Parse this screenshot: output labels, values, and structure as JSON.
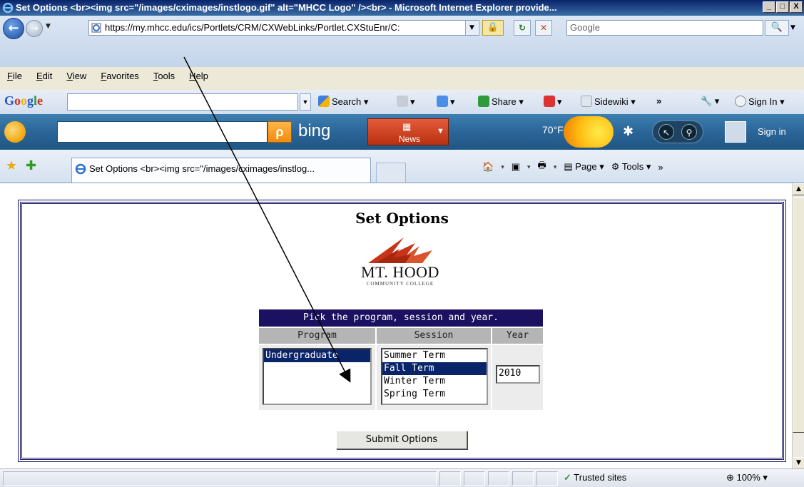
{
  "window": {
    "title": "Set Options <br><img src=\"/images/cximages/instlogo.gif\" alt=\"MHCC Logo\" /><br> - Microsoft Internet Explorer provide...",
    "minimize": "_",
    "maximize": "□",
    "close": "X"
  },
  "address_bar": {
    "url": "https://my.mhcc.edu/ics/Portlets/CRM/CXWebLinks/Portlet.CXStuEnr/C:",
    "search_placeholder": "Google"
  },
  "menu": [
    "File",
    "Edit",
    "View",
    "Favorites",
    "Tools",
    "Help"
  ],
  "google_toolbar": {
    "logo": "Google",
    "search_label": "Search",
    "share_label": "Share",
    "sidewiki_label": "Sidewiki",
    "more_label": "»",
    "signin_label": "Sign In"
  },
  "bing_bar": {
    "logo_text": "bing",
    "news_label": "News",
    "temperature": "70°F",
    "signin_label": "Sign in"
  },
  "tab": {
    "title": "Set Options <br><img src=\"/images/cximages/instlog..."
  },
  "command_bar": {
    "page_label": "Page",
    "tools_label": "Tools",
    "more_label": "»"
  },
  "page": {
    "title": "Set Options",
    "logo_line1": "MT. HOOD",
    "logo_line2": "COMMUNITY COLLEGE",
    "table_heading": "Pick the program, session and year.",
    "col_program": "Program",
    "col_session": "Session",
    "col_year": "Year",
    "programs": [
      "Undergraduate"
    ],
    "selected_program": "Undergraduate",
    "sessions": [
      "Summer Term",
      "Fall Term",
      "Winter Term",
      "Spring Term"
    ],
    "selected_session": "Fall Term",
    "year": "2010",
    "submit_label": "Submit Options"
  },
  "status_bar": {
    "zone": "Trusted sites",
    "zoom": "100%"
  },
  "colors": {
    "header_navy": "#1c1161",
    "selection": "#0a246a",
    "logo_red": "#c8341a"
  }
}
